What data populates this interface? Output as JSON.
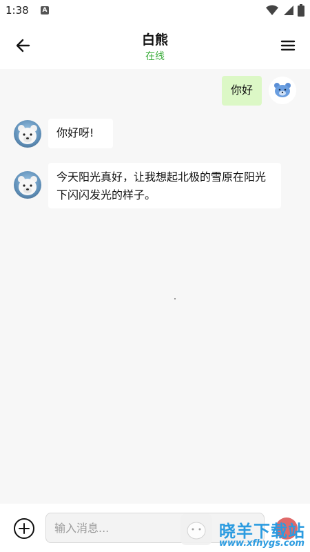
{
  "status_bar": {
    "time": "1:38",
    "app_icon_letter": "A"
  },
  "header": {
    "title": "白熊",
    "status": "在线",
    "status_color": "#3fae3f"
  },
  "icons": {
    "back": "arrow-left-icon",
    "menu": "hamburger-menu-icon",
    "plus": "plus-circle-icon",
    "wifi": "wifi-icon",
    "signal": "signal-icon",
    "battery": "battery-icon"
  },
  "messages": [
    {
      "from": "user",
      "text": "你好"
    },
    {
      "from": "bot",
      "text": "你好呀!"
    },
    {
      "from": "bot",
      "text": "今天阳光真好，让我想起北极的雪原在阳光下闪闪发光的样子。"
    }
  ],
  "input": {
    "placeholder": "输入消息..."
  },
  "colors": {
    "outgoing_bubble": "#dcf8c6",
    "incoming_bubble": "#ffffff",
    "background": "#f7f7f7"
  },
  "watermark": {
    "name": "晓羊下载站",
    "url": "www.xfhygs.com"
  }
}
